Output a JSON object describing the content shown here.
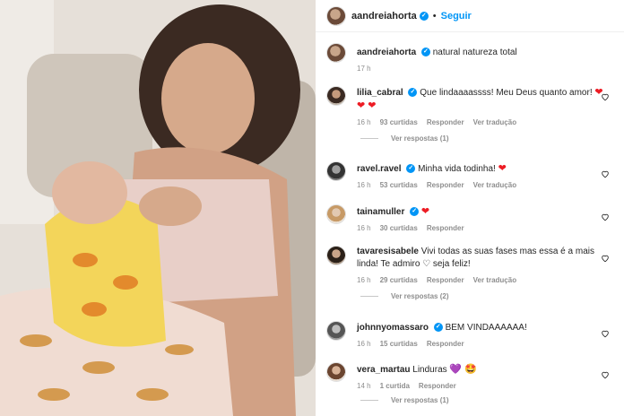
{
  "post": {
    "username": "aandreiahorta",
    "follow_label": "Seguir",
    "caption_text": "natural natureza total",
    "caption_time": "17 h"
  },
  "comments": [
    {
      "user": "lilia_cabral",
      "verified": true,
      "text": "Que lindaaaassss! Meu Deus quanto amor!",
      "emoji": "❤ ❤ ❤",
      "time": "16 h",
      "likes": "93 curtidas",
      "reply": "Responder",
      "translate": "Ver tradução",
      "replies": "Ver respostas (1)"
    },
    {
      "user": "ravel.ravel",
      "verified": true,
      "text": "Minha vida todinha!",
      "emoji": "❤",
      "time": "16 h",
      "likes": "53 curtidas",
      "reply": "Responder",
      "translate": "Ver tradução"
    },
    {
      "user": "tainamuller",
      "verified": true,
      "text": "",
      "emoji": "❤",
      "time": "16 h",
      "likes": "30 curtidas",
      "reply": "Responder"
    },
    {
      "user": "tavaresisabele",
      "verified": false,
      "text": "Vivi todas as suas fases mas essa é a mais linda! Te admiro ♡ seja feliz!",
      "emoji": "",
      "time": "16 h",
      "likes": "29 curtidas",
      "reply": "Responder",
      "translate": "Ver tradução",
      "replies": "Ver respostas (2)"
    },
    {
      "user": "johnnyomassaro",
      "verified": true,
      "text": "BEM VINDAAAAAA!",
      "emoji": "",
      "time": "16 h",
      "likes": "15 curtidas",
      "reply": "Responder"
    },
    {
      "user": "vera_martau",
      "verified": false,
      "text": "Linduras",
      "emoji": "💜 🤩",
      "time": "14 h",
      "likes": "1 curtida",
      "reply": "Responder",
      "replies": "Ver respostas (1)"
    }
  ],
  "icons": {
    "verified": "verified-badge-icon",
    "like": "heart-outline-icon"
  },
  "colors": {
    "accent": "#0095f6",
    "heart": "#ed1c24",
    "muted": "#8e8e8e"
  }
}
